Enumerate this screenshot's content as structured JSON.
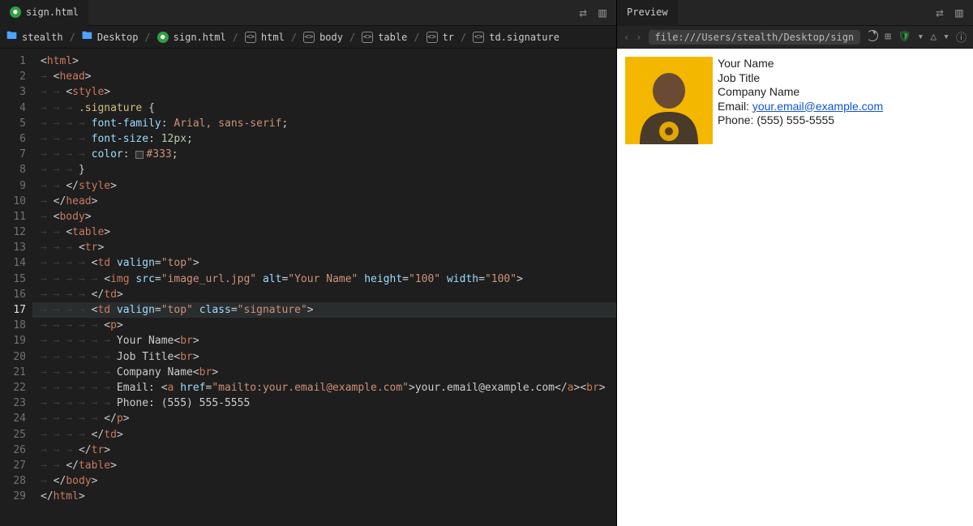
{
  "editor": {
    "tab_label": "sign.html",
    "actions": {
      "diff": "⇄",
      "split": "▥"
    }
  },
  "breadcrumb": {
    "items": [
      {
        "icon": "folder",
        "label": "stealth"
      },
      {
        "icon": "folder",
        "label": "Desktop"
      },
      {
        "icon": "html5",
        "label": "sign.html"
      },
      {
        "icon": "tag",
        "label": "html"
      },
      {
        "icon": "tag",
        "label": "body"
      },
      {
        "icon": "tag",
        "label": "table"
      },
      {
        "icon": "tag",
        "label": "tr"
      },
      {
        "icon": "tag",
        "label": "td.signature"
      }
    ]
  },
  "code": {
    "active_line": 17,
    "lines": [
      "<html>",
      "  <head>",
      "    <style>",
      "      .signature {",
      "        font-family: Arial, sans-serif;",
      "        font-size: 12px;",
      "        color: ▪#333;",
      "      }",
      "    </style>",
      "  </head>",
      "  <body>",
      "    <table>",
      "      <tr>",
      "        <td valign=\"top\">",
      "          <img src=\"image_url.jpg\" alt=\"Your Name\" height=\"100\" width=\"100\">",
      "        </td>",
      "        <td valign=\"top\" class=\"signature\">",
      "          <p>",
      "            Your Name<br>",
      "            Job Title<br>",
      "            Company Name<br>",
      "            Email: <a href=\"mailto:your.email@example.com\">your.email@example.com</a><br>",
      "            Phone: (555) 555-5555",
      "          </p>",
      "        </td>",
      "      </tr>",
      "    </table>",
      "  </body>",
      "</html>"
    ]
  },
  "preview": {
    "tab_label": "Preview",
    "url": "file:///Users/stealth/Desktop/sign",
    "signature": {
      "name": "Your Name",
      "title": "Job Title",
      "company": "Company Name",
      "email_label": "Email: ",
      "email": "your.email@example.com",
      "phone_label": "Phone: ",
      "phone": "(555) 555-5555"
    }
  }
}
